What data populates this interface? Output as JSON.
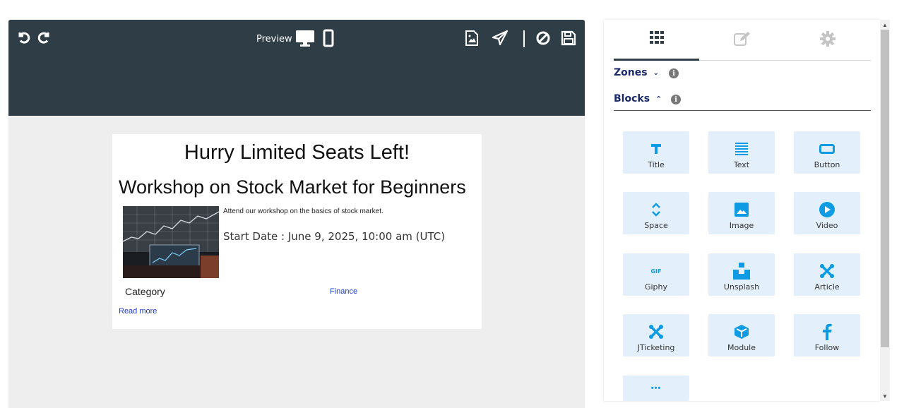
{
  "toolbar": {
    "preview_label": "Preview"
  },
  "email": {
    "heading": "Hurry Limited Seats Left!",
    "title": "Workshop on Stock Market for Beginners",
    "description": "Attend our workshop on the basics of stock market.",
    "start_date": "Start Date : June 9, 2025, 10:00 am (UTC)",
    "category_label": "Category",
    "category_value": "Finance",
    "read_more": "Read more"
  },
  "panel": {
    "zones_label": "Zones",
    "blocks_label": "Blocks",
    "info_glyph": "i",
    "blocks": [
      {
        "label": "Title",
        "icon": "title-icon"
      },
      {
        "label": "Text",
        "icon": "text-lines-icon"
      },
      {
        "label": "Button",
        "icon": "button-icon"
      },
      {
        "label": "Space",
        "icon": "space-icon"
      },
      {
        "label": "Image",
        "icon": "image-icon"
      },
      {
        "label": "Video",
        "icon": "video-icon"
      },
      {
        "label": "Giphy",
        "icon": "gif-icon"
      },
      {
        "label": "Unsplash",
        "icon": "unsplash-icon"
      },
      {
        "label": "Article",
        "icon": "joomla-icon"
      },
      {
        "label": "JTicketing",
        "icon": "joomla-icon"
      },
      {
        "label": "Module",
        "icon": "cube-icon"
      },
      {
        "label": "Follow",
        "icon": "facebook-icon"
      }
    ],
    "gif_text": "GIF",
    "more_glyph": "•••"
  },
  "colors": {
    "toolbar_bg": "#2f3e46",
    "accent_icon": "#0e9be3",
    "block_bg": "#e3effa",
    "link": "#1a3ad1"
  }
}
